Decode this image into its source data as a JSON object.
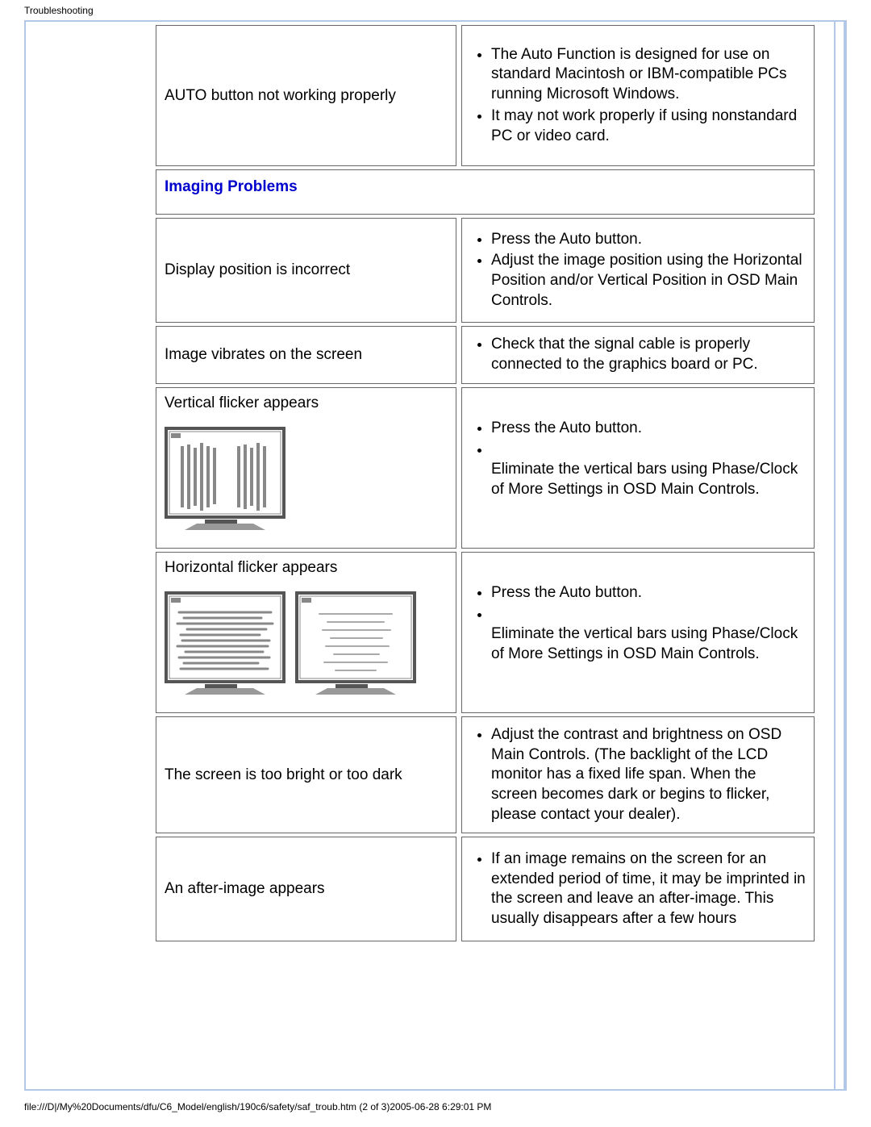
{
  "header": {
    "title": "Troubleshooting"
  },
  "footer": {
    "text": "file:///D|/My%20Documents/dfu/C6_Model/english/190c6/safety/saf_troub.htm (2 of 3)2005-06-28 6:29:01 PM"
  },
  "table": {
    "rows": [
      {
        "problem": "AUTO button not working properly",
        "solutions": [
          "The Auto Function is designed for use on standard Macintosh or IBM-compatible PCs running Microsoft Windows.",
          "It may not work properly if using nonstandard PC or video card."
        ]
      },
      {
        "section_header": "Imaging Problems"
      },
      {
        "problem": "Display position is incorrect",
        "solutions": [
          "Press the Auto button.",
          "Adjust the image position using the Horizontal Position and/or Vertical Position in OSD Main Controls."
        ]
      },
      {
        "problem": "Image vibrates on the screen",
        "solutions": [
          "Check that the signal cable is properly connected to the graphics board or PC."
        ]
      },
      {
        "problem": "Vertical flicker appears",
        "solutions": [
          "Press the Auto button.",
          "",
          "Eliminate the vertical bars using Phase/Clock of More Settings in OSD Main Controls."
        ],
        "figure": "vertical"
      },
      {
        "problem": "Horizontal flicker appears",
        "solutions": [
          "Press the Auto button.",
          "",
          "Eliminate the vertical bars using Phase/Clock of More Settings in OSD Main Controls."
        ],
        "figure": "horizontal"
      },
      {
        "problem": "The screen is too bright or too dark",
        "solutions": [
          "Adjust the contrast and brightness on OSD Main Controls. (The backlight of the LCD monitor has a fixed life span. When the screen becomes dark or begins to flicker, please contact your dealer)."
        ]
      },
      {
        "problem": "An after-image appears",
        "solutions": [
          "If an image remains on the screen for an extended period of time, it may be imprinted in the screen and leave an after-image. This usually disappears after a few hours"
        ]
      }
    ]
  }
}
